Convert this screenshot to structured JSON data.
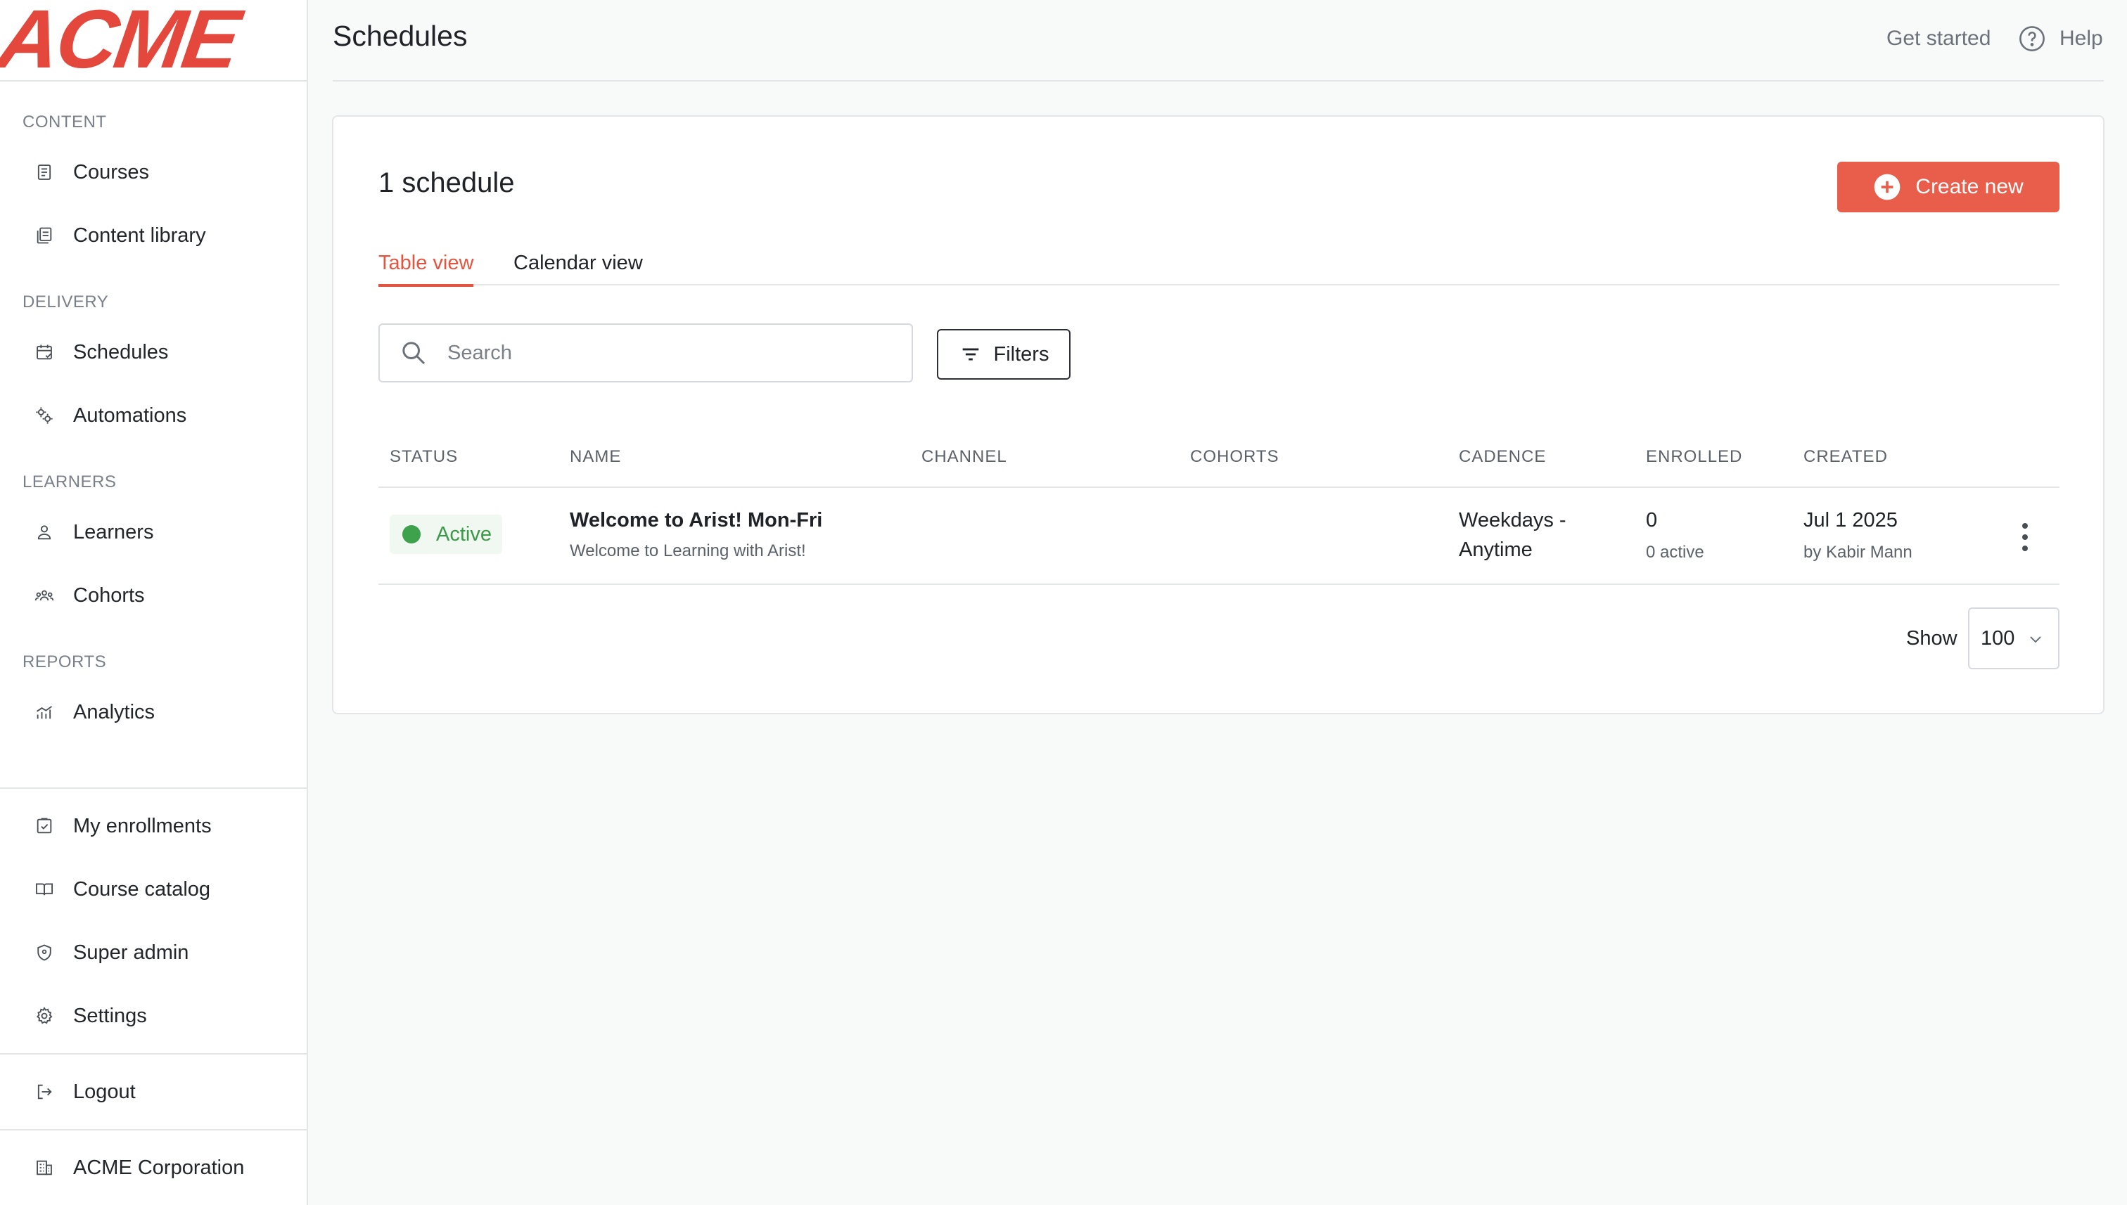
{
  "logo": {
    "text": "ACME"
  },
  "sidebar": {
    "sections": [
      {
        "title": "CONTENT",
        "items": [
          {
            "label": "Courses",
            "icon": "courses-icon"
          },
          {
            "label": "Content library",
            "icon": "library-icon"
          }
        ]
      },
      {
        "title": "DELIVERY",
        "items": [
          {
            "label": "Schedules",
            "icon": "calendar-icon"
          },
          {
            "label": "Automations",
            "icon": "automations-icon"
          }
        ]
      },
      {
        "title": "LEARNERS",
        "items": [
          {
            "label": "Learners",
            "icon": "user-icon"
          },
          {
            "label": "Cohorts",
            "icon": "cohorts-icon"
          }
        ]
      },
      {
        "title": "REPORTS",
        "items": [
          {
            "label": "Analytics",
            "icon": "analytics-icon"
          }
        ]
      }
    ],
    "bottom_items": [
      {
        "label": "My enrollments",
        "icon": "enrollments-icon"
      },
      {
        "label": "Course catalog",
        "icon": "book-icon"
      },
      {
        "label": "Super admin",
        "icon": "shield-icon"
      },
      {
        "label": "Settings",
        "icon": "gear-icon"
      }
    ],
    "logout": {
      "label": "Logout",
      "icon": "logout-icon"
    },
    "org": {
      "label": "ACME Corporation",
      "icon": "building-icon"
    }
  },
  "header": {
    "title": "Schedules",
    "get_started": "Get started",
    "help": "Help"
  },
  "main": {
    "count_title": "1 schedule",
    "create_button": "Create new",
    "tabs": [
      {
        "label": "Table view",
        "active": true
      },
      {
        "label": "Calendar view",
        "active": false
      }
    ],
    "search": {
      "placeholder": "Search",
      "value": ""
    },
    "filters_button": "Filters",
    "columns": [
      "STATUS",
      "NAME",
      "CHANNEL",
      "COHORTS",
      "CADENCE",
      "ENROLLED",
      "CREATED"
    ],
    "rows": [
      {
        "status": "Active",
        "name": "Welcome to Arist! Mon-Fri",
        "description": "Welcome to Learning with Arist!",
        "channel": "",
        "cohorts": "",
        "cadence_line1": "Weekdays -",
        "cadence_line2": "Anytime",
        "enrolled": "0",
        "enrolled_sub": "0 active",
        "created": "Jul 1 2025",
        "created_by": "by Kabir Mann"
      }
    ],
    "pagination": {
      "show_label": "Show",
      "page_size": "100"
    }
  },
  "colors": {
    "brand": "#e4473c",
    "accent": "#e95d4b",
    "active_status": "#3da24b"
  }
}
